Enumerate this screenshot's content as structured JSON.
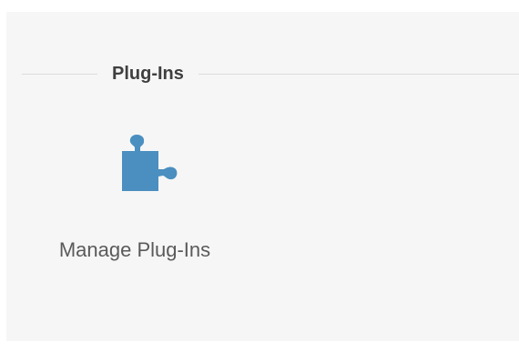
{
  "plugins_section": {
    "title": "Plug-Ins",
    "items": [
      {
        "label": "Manage Plug-Ins",
        "icon": "puzzle-piece-icon",
        "icon_color": "#4a8fbf"
      }
    ]
  }
}
